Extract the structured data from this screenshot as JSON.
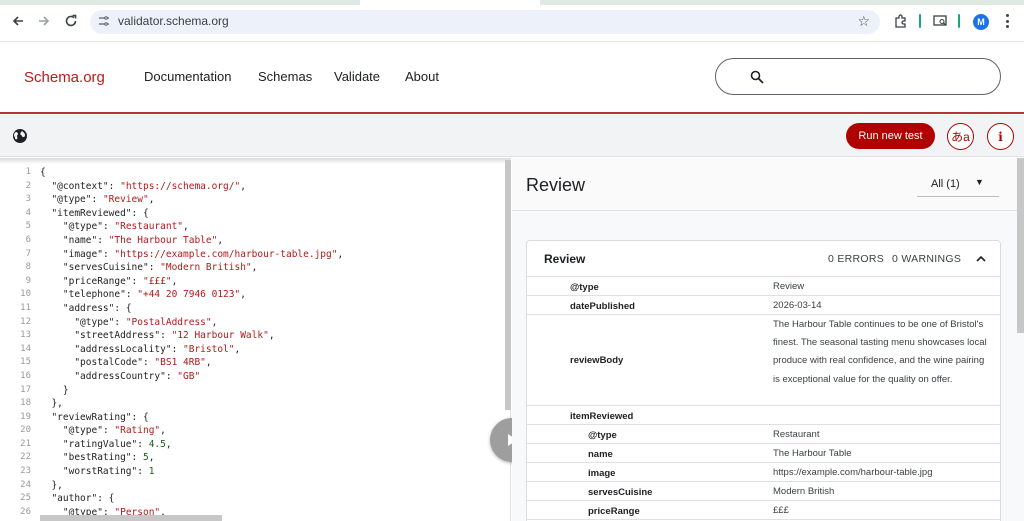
{
  "browser": {
    "url": "validator.schema.org",
    "avatar_letter": "M"
  },
  "site": {
    "logo": "Schema.org",
    "nav": [
      "Documentation",
      "Schemas",
      "Validate",
      "About"
    ]
  },
  "toolbar": {
    "run_label": "Run new test",
    "lang_label": "あa",
    "info_label": "i"
  },
  "code": {
    "line_numbers": [
      "1",
      "2",
      "3",
      "4",
      "5",
      "6",
      "7",
      "8",
      "9",
      "10",
      "11",
      "12",
      "13",
      "14",
      "15",
      "16",
      "17",
      "18",
      "19",
      "20",
      "21",
      "22",
      "23",
      "24",
      "25",
      "26"
    ],
    "lines": [
      "{",
      "  \"@context\": \"https://schema.org/\",",
      "  \"@type\": \"Review\",",
      "  \"itemReviewed\": {",
      "    \"@type\": \"Restaurant\",",
      "    \"name\": \"The Harbour Table\",",
      "    \"image\": \"https://example.com/harbour-table.jpg\",",
      "    \"servesCuisine\": \"Modern British\",",
      "    \"priceRange\": \"£££\",",
      "    \"telephone\": \"+44 20 7946 0123\",",
      "    \"address\": {",
      "      \"@type\": \"PostalAddress\",",
      "      \"streetAddress\": \"12 Harbour Walk\",",
      "      \"addressLocality\": \"Bristol\",",
      "      \"postalCode\": \"BS1 4RB\",",
      "      \"addressCountry\": \"GB\"",
      "    }",
      "  },",
      "  \"reviewRating\": {",
      "    \"@type\": \"Rating\",",
      "    \"ratingValue\": 4.5,",
      "    \"bestRating\": 5,",
      "    \"worstRating\": 1",
      "  },",
      "  \"author\": {",
      "    \"@type\": \"Person\","
    ]
  },
  "results": {
    "title": "Review",
    "filter_label": "All (1)",
    "card": {
      "title": "Review",
      "errors": "0 ERRORS",
      "warnings": "0 WARNINGS"
    },
    "rows": [
      {
        "key": "@type",
        "value": "Review",
        "nested": false
      },
      {
        "key": "datePublished",
        "value": "2026-03-14",
        "nested": false
      },
      {
        "key": "reviewBody",
        "value": "The Harbour Table continues to be one of Bristol's finest. The seasonal tasting menu showcases local produce with real confidence, and the wine pairing is exceptional value for the quality on offer.",
        "nested": false
      },
      {
        "key": "itemReviewed",
        "value": "",
        "nested": false
      },
      {
        "key": "@type",
        "value": "Restaurant",
        "nested": true
      },
      {
        "key": "name",
        "value": "The Harbour Table",
        "nested": true
      },
      {
        "key": "image",
        "value": "https://example.com/harbour-table.jpg",
        "nested": true
      },
      {
        "key": "servesCuisine",
        "value": "Modern British",
        "nested": true
      },
      {
        "key": "priceRange",
        "value": "£££",
        "nested": true
      }
    ]
  },
  "colors": {
    "brand": "#b00000",
    "logo": "#b71c1c"
  }
}
